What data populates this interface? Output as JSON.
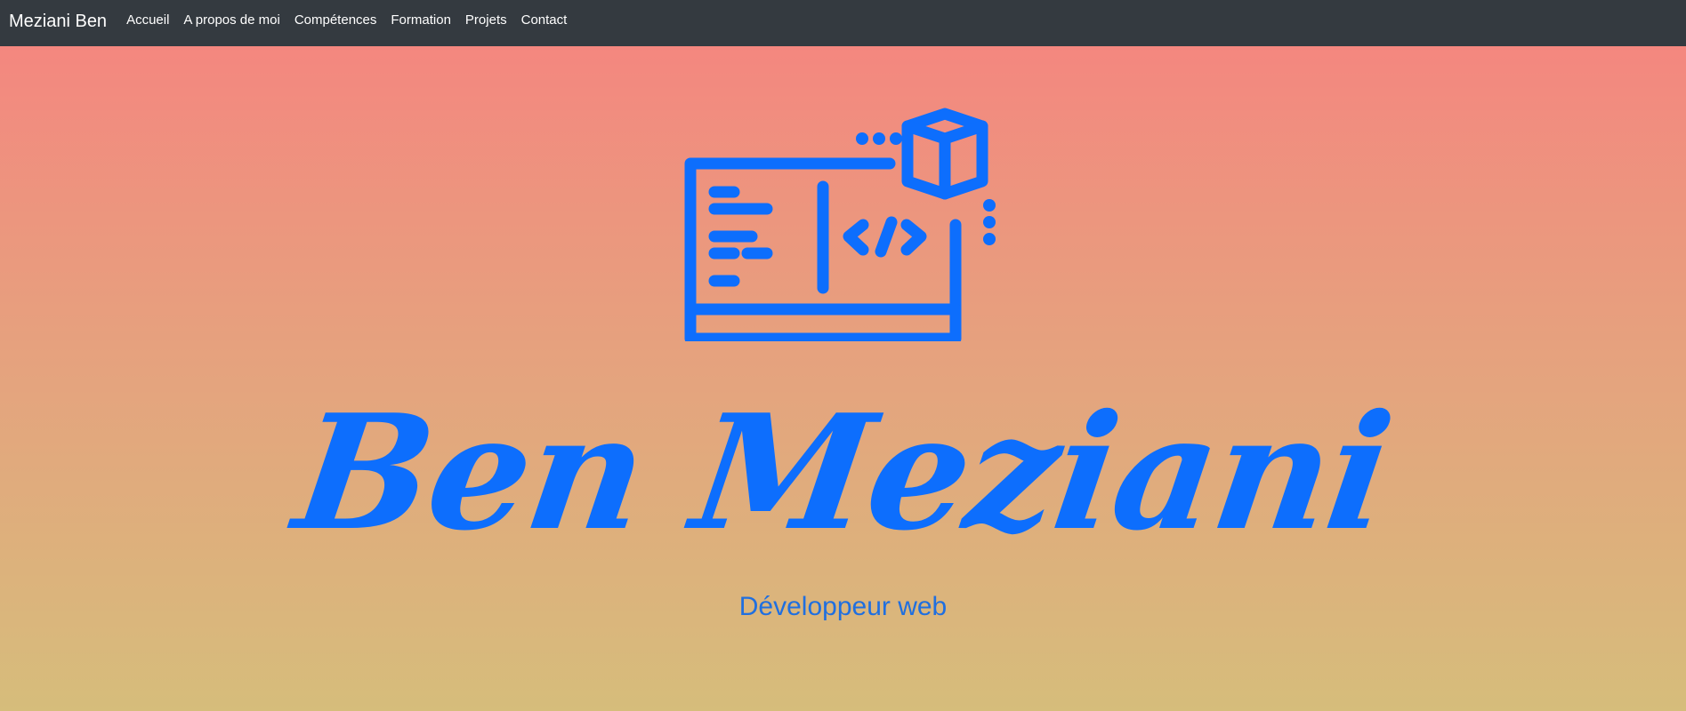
{
  "navbar": {
    "brand": "Meziani Ben",
    "links": [
      {
        "label": "Accueil"
      },
      {
        "label": "A propos de moi"
      },
      {
        "label": "Compétences"
      },
      {
        "label": "Formation"
      },
      {
        "label": "Projets"
      },
      {
        "label": "Contact"
      }
    ]
  },
  "hero": {
    "icon": "web-developer-monitor-icon",
    "name": "Ben Meziani",
    "subtitle": "Développeur web"
  },
  "colors": {
    "navbar_bg": "#343a40",
    "accent": "#0d6efd",
    "gradient_top": "#f4877f",
    "gradient_bottom": "#d6bd7b"
  }
}
